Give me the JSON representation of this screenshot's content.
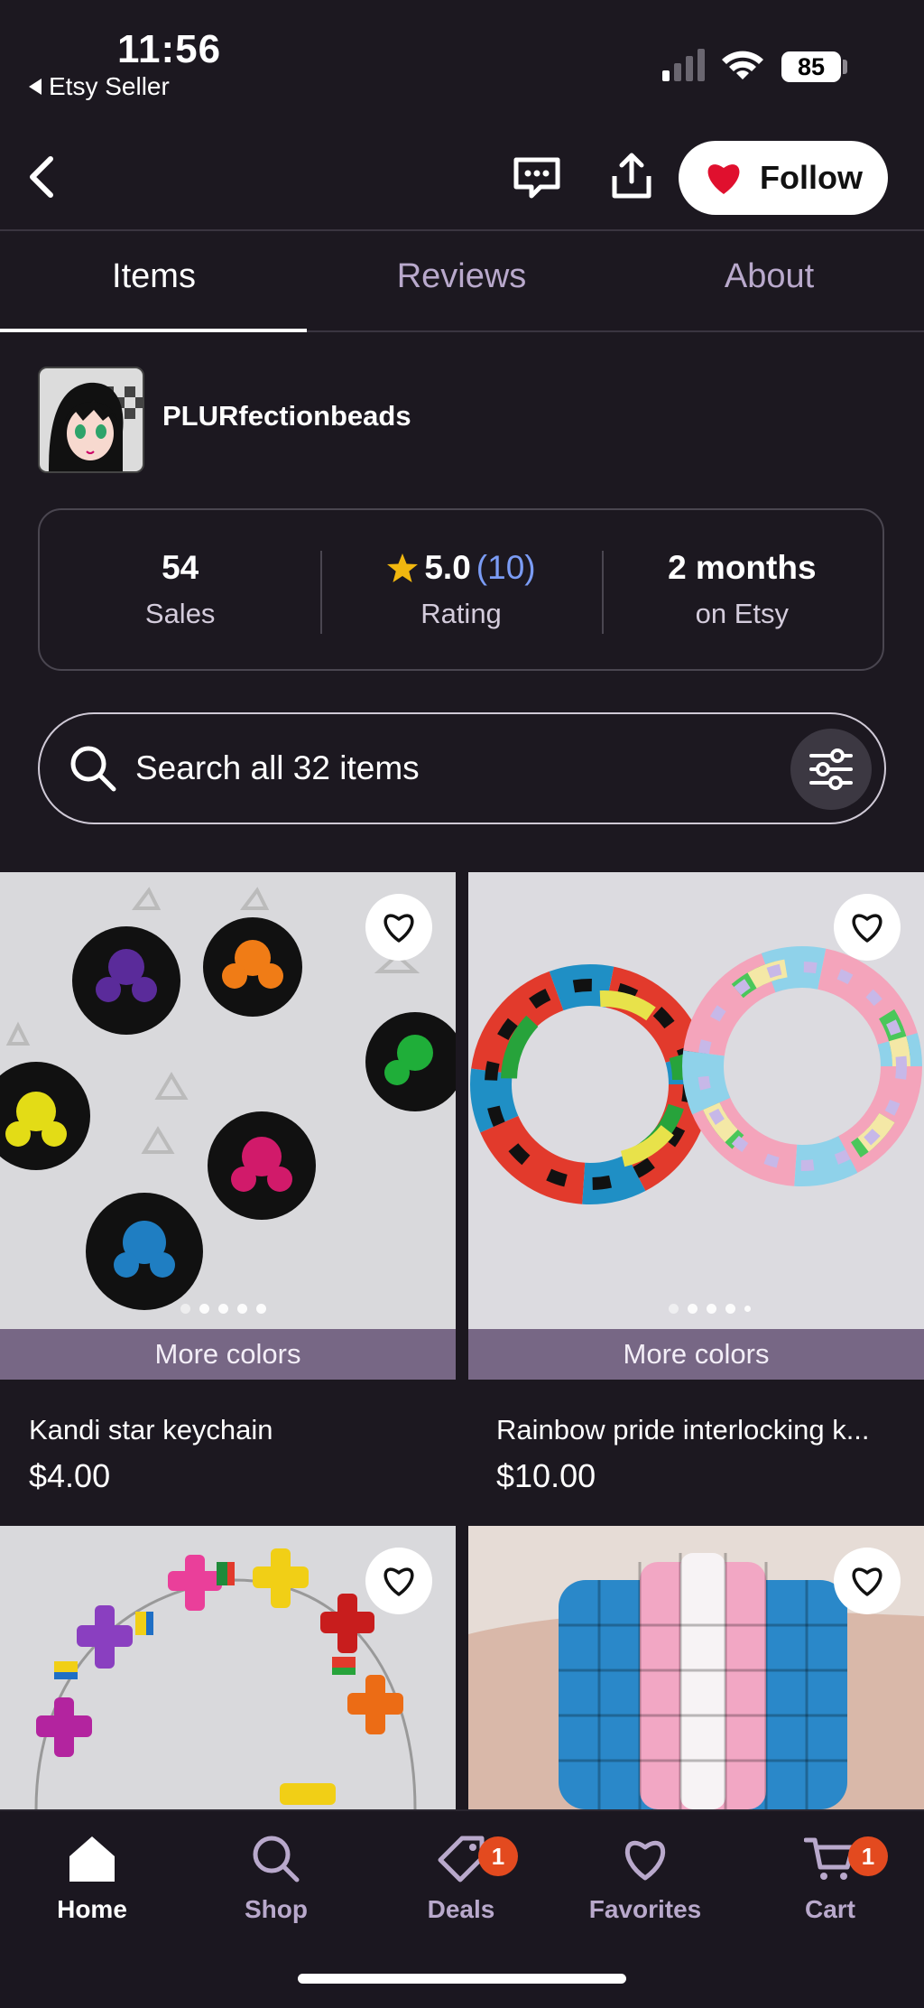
{
  "status_bar": {
    "time": "11:56",
    "back_app": "Etsy Seller",
    "battery": "85"
  },
  "header": {
    "follow_label": "Follow"
  },
  "tabs": [
    {
      "label": "Items"
    },
    {
      "label": "Reviews"
    },
    {
      "label": "About"
    }
  ],
  "shop": {
    "name": "PLURfectionbeads"
  },
  "stats": {
    "sales_value": "54",
    "sales_label": "Sales",
    "rating_value": "5.0",
    "rating_count": "(10)",
    "rating_label": "Rating",
    "age_value": "2 months",
    "age_label": "on Etsy"
  },
  "search": {
    "placeholder": "Search all 32 items"
  },
  "listings": [
    {
      "title": "Kandi star keychain",
      "price": "$4.00",
      "badge": "More colors"
    },
    {
      "title": "Rainbow pride interlocking k...",
      "price": "$10.00",
      "badge": "More colors"
    }
  ],
  "bottom_nav": [
    {
      "label": "Home"
    },
    {
      "label": "Shop"
    },
    {
      "label": "Deals",
      "badge": "1"
    },
    {
      "label": "Favorites"
    },
    {
      "label": "Cart",
      "badge": "1"
    }
  ],
  "colors": {
    "background": "#1c1820",
    "accent_purple": "#776785",
    "rating_blue": "#7b9cf5",
    "star": "#f1b70f",
    "badge": "#e34a1f",
    "heart_red": "#e0102e"
  }
}
